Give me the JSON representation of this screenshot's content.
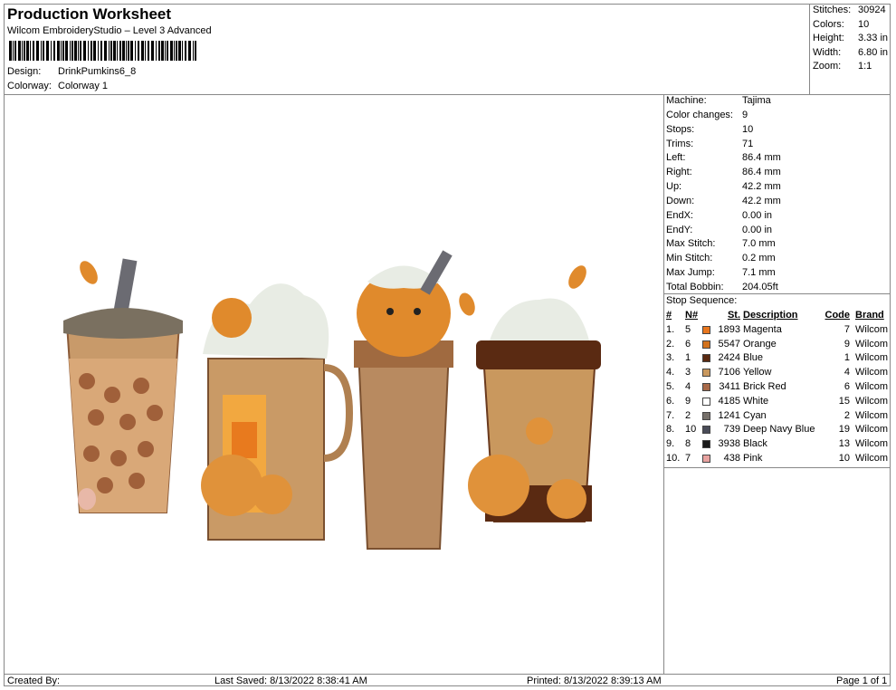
{
  "header": {
    "title": "Production Worksheet",
    "software": "Wilcom EmbroideryStudio – Level 3 Advanced",
    "design_label": "Design:",
    "design_value": "DrinkPumkins6_8",
    "colorway_label": "Colorway:",
    "colorway_value": "Colorway 1"
  },
  "summary": [
    {
      "label": "Stitches:",
      "value": "30924"
    },
    {
      "label": "Colors:",
      "value": "10"
    },
    {
      "label": "Height:",
      "value": "3.33 in"
    },
    {
      "label": "Width:",
      "value": "6.80 in"
    },
    {
      "label": "Zoom:",
      "value": "1:1"
    }
  ],
  "machine_info": [
    {
      "label": "Machine:",
      "value": "Tajima"
    },
    {
      "label": "Color changes:",
      "value": "9"
    },
    {
      "label": "Stops:",
      "value": "10"
    },
    {
      "label": "Trims:",
      "value": "71"
    },
    {
      "label": "Left:",
      "value": "86.4 mm"
    },
    {
      "label": "Right:",
      "value": "86.4 mm"
    },
    {
      "label": "Up:",
      "value": "42.2 mm"
    },
    {
      "label": "Down:",
      "value": "42.2 mm"
    },
    {
      "label": "EndX:",
      "value": "0.00 in"
    },
    {
      "label": "EndY:",
      "value": "0.00 in"
    },
    {
      "label": "Max Stitch:",
      "value": "7.0 mm"
    },
    {
      "label": "Min Stitch:",
      "value": "0.2 mm"
    },
    {
      "label": "Max Jump:",
      "value": "7.1 mm"
    },
    {
      "label": "Total Bobbin:",
      "value": "204.05ft"
    }
  ],
  "stop_sequence": {
    "title": "Stop Sequence:",
    "columns": [
      "#",
      "N#",
      "St.",
      "Description",
      "Code",
      "Brand"
    ],
    "rows": [
      {
        "num": "1.",
        "n": "5",
        "color": "#e8761e",
        "st": "1893",
        "desc": "Magenta",
        "code": "7",
        "brand": "Wilcom"
      },
      {
        "num": "2.",
        "n": "6",
        "color": "#d2721c",
        "st": "5547",
        "desc": "Orange",
        "code": "9",
        "brand": "Wilcom"
      },
      {
        "num": "3.",
        "n": "1",
        "color": "#5a2a12",
        "st": "2424",
        "desc": "Blue",
        "code": "1",
        "brand": "Wilcom"
      },
      {
        "num": "4.",
        "n": "3",
        "color": "#c9985e",
        "st": "7106",
        "desc": "Yellow",
        "code": "4",
        "brand": "Wilcom"
      },
      {
        "num": "5.",
        "n": "4",
        "color": "#a86a4a",
        "st": "3411",
        "desc": "Brick Red",
        "code": "6",
        "brand": "Wilcom"
      },
      {
        "num": "6.",
        "n": "9",
        "color": "#ffffff",
        "st": "4185",
        "desc": "White",
        "code": "15",
        "brand": "Wilcom"
      },
      {
        "num": "7.",
        "n": "2",
        "color": "#76706a",
        "st": "1241",
        "desc": "Cyan",
        "code": "2",
        "brand": "Wilcom"
      },
      {
        "num": "8.",
        "n": "10",
        "color": "#4a4c58",
        "st": "739",
        "desc": "Deep Navy Blue",
        "code": "19",
        "brand": "Wilcom"
      },
      {
        "num": "9.",
        "n": "8",
        "color": "#1a1a1a",
        "st": "3938",
        "desc": "Black",
        "code": "13",
        "brand": "Wilcom"
      },
      {
        "num": "10.",
        "n": "7",
        "color": "#e8a2a0",
        "st": "438",
        "desc": "Pink",
        "code": "10",
        "brand": "Wilcom"
      }
    ]
  },
  "footer": {
    "created_by": "Created By:",
    "last_saved": "Last Saved: 8/13/2022 8:38:41 AM",
    "printed": "Printed: 8/13/2022 8:39:13 AM",
    "page": "Page 1 of 1"
  }
}
